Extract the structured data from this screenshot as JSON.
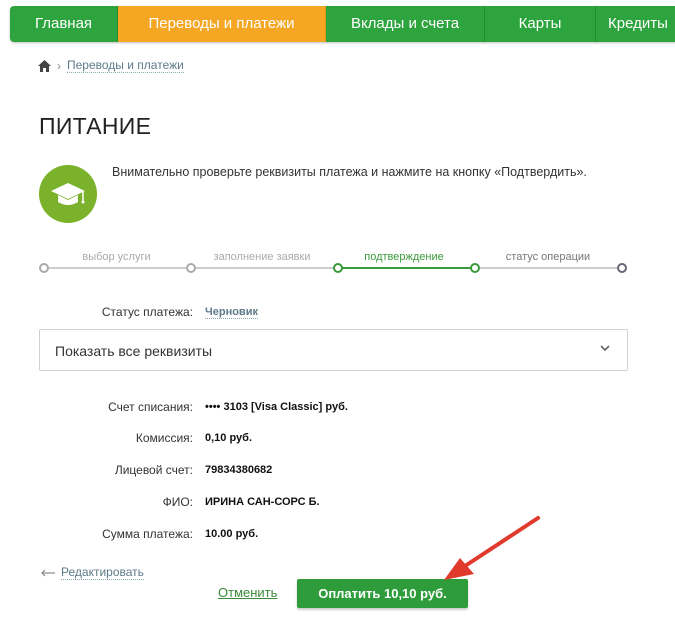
{
  "nav": {
    "items": [
      {
        "label": "Главная"
      },
      {
        "label": "Переводы и платежи",
        "active": true
      },
      {
        "label": "Вклады и счета"
      },
      {
        "label": "Карты"
      },
      {
        "label": "Кредиты"
      }
    ],
    "green": "#2ea43f",
    "orange": "#f5a623"
  },
  "breadcrumb": {
    "home_icon": "home-icon",
    "current": "Переводы и платежи"
  },
  "page": {
    "title": "ПИТАНИЕ",
    "service_icon": "graduation-cap-icon",
    "notice": "Внимательно проверьте реквизиты платежа и нажмите на кнопку «Подтвердить»."
  },
  "steps": [
    {
      "label": "выбор услуги",
      "state": "done"
    },
    {
      "label": "заполнение заявки",
      "state": "done"
    },
    {
      "label": "подтверждение",
      "state": "current"
    },
    {
      "label": "статус операции",
      "state": "future"
    }
  ],
  "status": {
    "label": "Статус платежа:",
    "value": "Черновик"
  },
  "details_toggle": {
    "label": "Показать все реквизиты"
  },
  "details": [
    {
      "label": "Счет списания:",
      "value": "•••• 3103  [Visa Classic]  руб."
    },
    {
      "label": "Комиссия:",
      "value": "0,10 руб."
    },
    {
      "label": "Лицевой счет:",
      "value": "79834380682"
    },
    {
      "label": "ФИО:",
      "value": "ИРИНА САН-СОРС Б."
    },
    {
      "label": "Сумма платежа:",
      "value": "10.00 руб."
    }
  ],
  "actions": {
    "edit": "Редактировать",
    "cancel": "Отменить",
    "pay": "Оплатить 10,10 руб."
  },
  "annotation": {
    "arrow_color": "#e03a2c"
  }
}
